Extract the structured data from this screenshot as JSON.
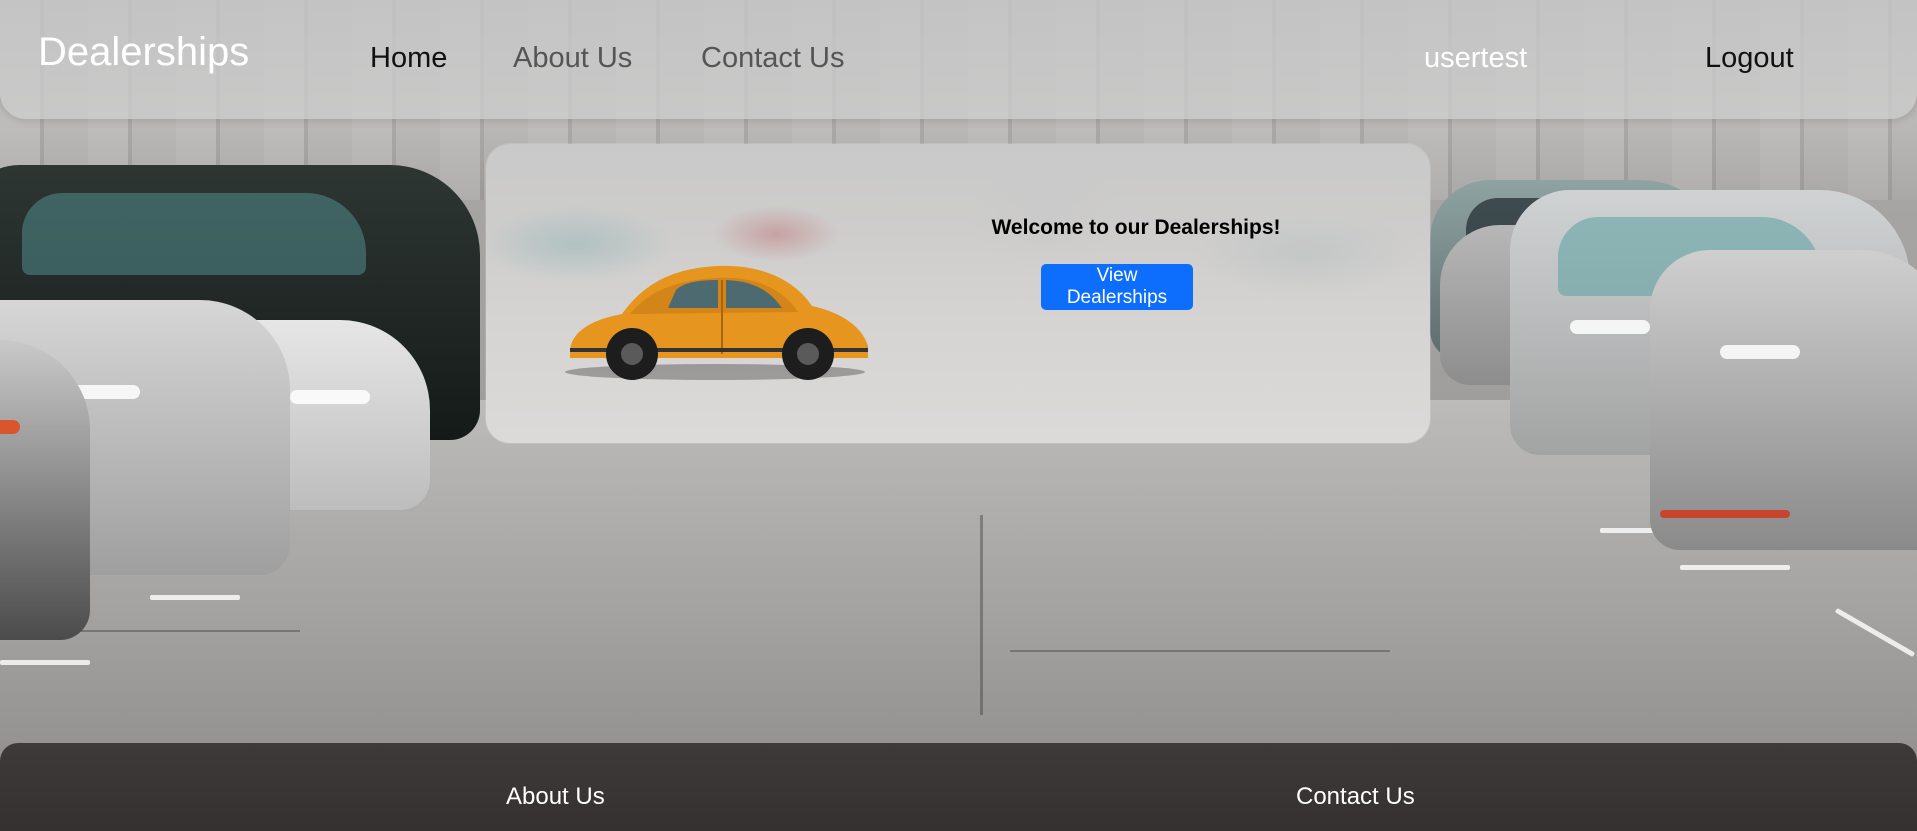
{
  "header": {
    "brand": "Dealerships",
    "nav": {
      "home": "Home",
      "about": "About Us",
      "contact": "Contact Us"
    },
    "username": "usertest",
    "logout": "Logout"
  },
  "hero": {
    "welcome": "Welcome to our Dealerships!",
    "button": "View Dealerships"
  },
  "footer": {
    "about": "About Us",
    "contact": "Contact Us"
  },
  "colors": {
    "primary_button": "#0d6efd",
    "footer_bg": "#3a3736",
    "header_bg": "#cdcdcd"
  }
}
